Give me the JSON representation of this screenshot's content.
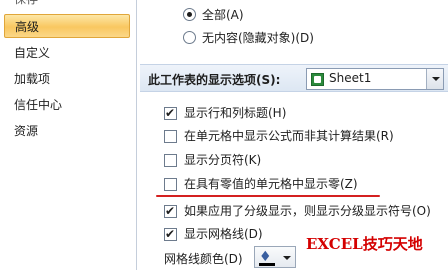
{
  "sidebar": {
    "items": [
      {
        "label": "保存"
      },
      {
        "label": "高级"
      },
      {
        "label": "自定义"
      },
      {
        "label": "加载项"
      },
      {
        "label": "信任中心"
      },
      {
        "label": "资源"
      }
    ],
    "selected_index": 1
  },
  "objects_display": {
    "options": [
      {
        "label": "全部(A)",
        "selected": true
      },
      {
        "label": "无内容(隐藏对象)(D)",
        "selected": false
      }
    ]
  },
  "sheet_options": {
    "title": "此工作表的显示选项(S):",
    "sheet_select_value": "Sheet1",
    "checkboxes": [
      {
        "label": "显示行和列标题(H)",
        "checked": true
      },
      {
        "label": "在单元格中显示公式而非其计算结果(R)",
        "checked": false
      },
      {
        "label": "显示分页符(K)",
        "checked": false
      },
      {
        "label": "在具有零值的单元格中显示零(Z)",
        "checked": false
      },
      {
        "label": "如果应用了分级显示，则显示分级显示符号(O)",
        "checked": true
      },
      {
        "label": "显示网格线(D)",
        "checked": true
      }
    ],
    "gridline_color_label": "网格线颜色(D)"
  },
  "watermark": "EXCEL技巧天地",
  "colors": {
    "selected_gradient_top": "#fde7a7",
    "selected_gradient_mid": "#f9c760",
    "highlight_underline": "#d42020",
    "watermark": "#d40000",
    "gridline_color": "#000000"
  }
}
